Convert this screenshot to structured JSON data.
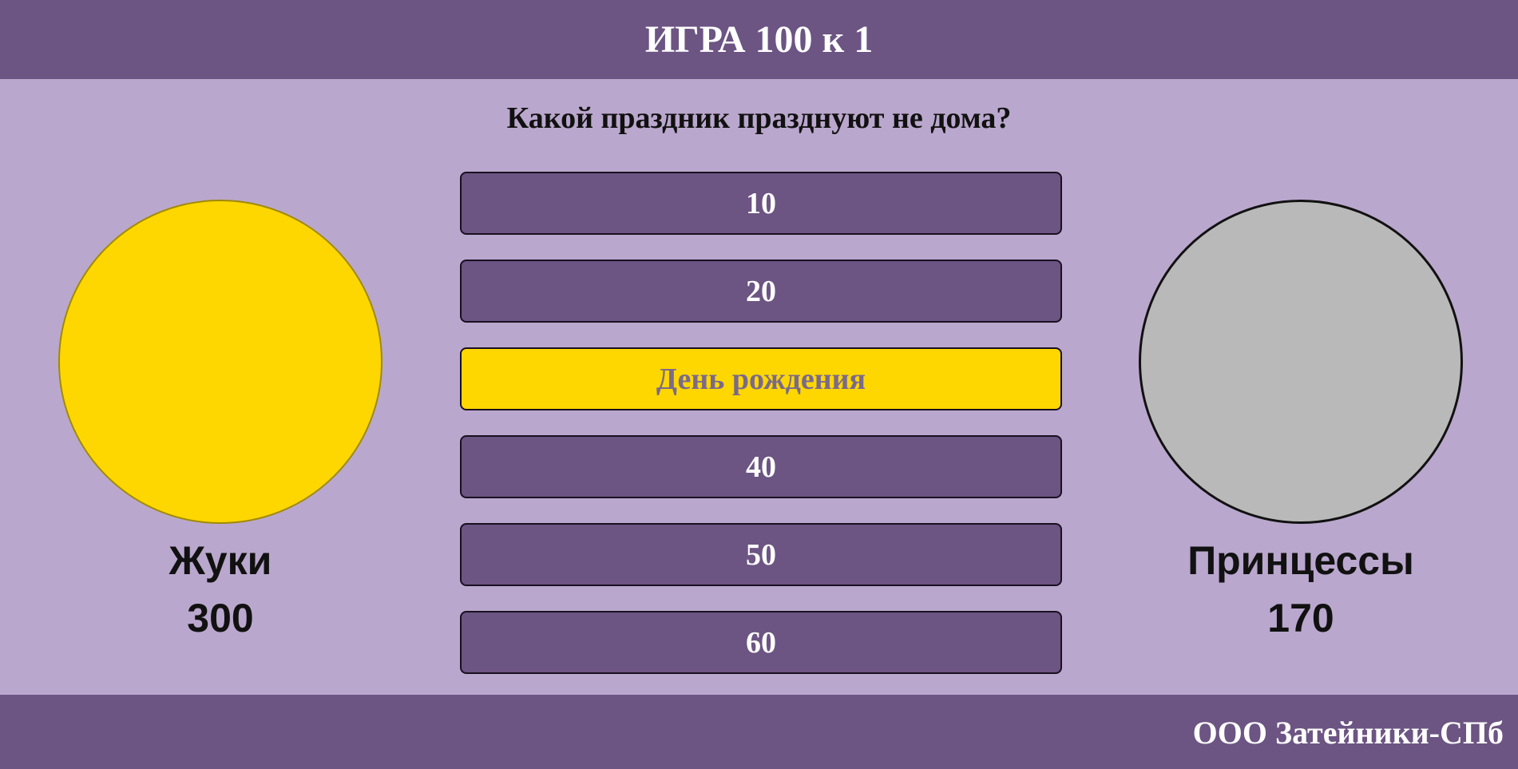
{
  "header": {
    "title": "ИГРА 100 к 1"
  },
  "question": {
    "text": "Какой праздник празднуют не дома?"
  },
  "answers": [
    {
      "label": "10",
      "revealed": false
    },
    {
      "label": "20",
      "revealed": false
    },
    {
      "label": "День рождения",
      "revealed": true
    },
    {
      "label": "40",
      "revealed": false
    },
    {
      "label": "50",
      "revealed": false
    },
    {
      "label": "60",
      "revealed": false
    }
  ],
  "teams": {
    "left": {
      "name": "Жуки",
      "score": "300",
      "active": true
    },
    "right": {
      "name": "Принцессы",
      "score": "170",
      "active": false
    }
  },
  "footer": {
    "text": "ООО Затейники-СПб"
  },
  "colors": {
    "background": "#baa7cd",
    "panel": "#6c5483",
    "highlight": "#ffd700",
    "inactive_circle": "#b9b9b9"
  }
}
